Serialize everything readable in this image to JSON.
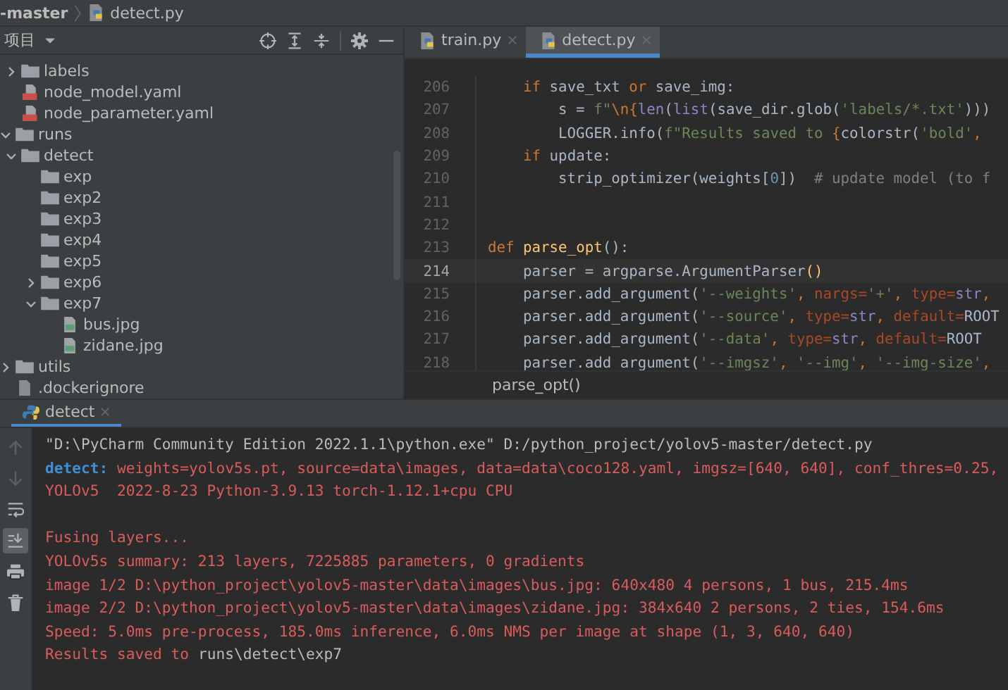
{
  "breadcrumb": [
    {
      "label": "-master"
    },
    {
      "label": "detect.py"
    }
  ],
  "project_panel": {
    "title": "项目",
    "tree": [
      {
        "children": [
          {
            "label": "labels",
            "kind": "folder",
            "expanded": false
          },
          {
            "label": "node_model.yaml",
            "kind": "yaml"
          },
          {
            "label": "node_parameter.yaml",
            "kind": "yaml"
          }
        ]
      },
      {
        "label": "runs",
        "kind": "folder",
        "expanded": true,
        "children": [
          {
            "label": "detect",
            "kind": "folder",
            "expanded": true,
            "children": [
              {
                "label": "exp",
                "kind": "folder"
              },
              {
                "label": "exp2",
                "kind": "folder"
              },
              {
                "label": "exp3",
                "kind": "folder"
              },
              {
                "label": "exp4",
                "kind": "folder"
              },
              {
                "label": "exp5",
                "kind": "folder"
              },
              {
                "label": "exp6",
                "kind": "folder",
                "expanded": false
              },
              {
                "label": "exp7",
                "kind": "folder",
                "expanded": true,
                "children": [
                  {
                    "label": "bus.jpg",
                    "kind": "image"
                  },
                  {
                    "label": "zidane.jpg",
                    "kind": "image"
                  }
                ]
              }
            ]
          }
        ]
      },
      {
        "label": "utils",
        "kind": "folder",
        "expanded": false
      },
      {
        "label": ".dockerignore",
        "kind": "file"
      }
    ]
  },
  "editor": {
    "tabs": [
      {
        "label": "train.py",
        "selected": false
      },
      {
        "label": "detect.py",
        "selected": true
      }
    ],
    "lines": [
      {
        "number": "206",
        "current": false,
        "segments": [
          {
            "text": "    if",
            "kind": "kw"
          },
          {
            "text": " save_txt ",
            "kind": "plain"
          },
          {
            "text": "or",
            "kind": "kw"
          },
          {
            "text": " save_img:",
            "kind": "plain"
          }
        ]
      },
      {
        "number": "207",
        "current": false,
        "segments": [
          {
            "text": "        s = ",
            "kind": "plain"
          },
          {
            "text": "f\"",
            "kind": "str"
          },
          {
            "text": "\\n{",
            "kind": "kw"
          },
          {
            "text": "len",
            "kind": "builtin"
          },
          {
            "text": "(",
            "kind": "plain"
          },
          {
            "text": "list",
            "kind": "builtin"
          },
          {
            "text": "(save_dir.glob(",
            "kind": "plain"
          },
          {
            "text": "'labels/*.txt'",
            "kind": "str"
          },
          {
            "text": ")))",
            "kind": "plain"
          }
        ]
      },
      {
        "number": "208",
        "current": false,
        "segments": [
          {
            "text": "        LOGGER.info(",
            "kind": "plain"
          },
          {
            "text": "f\"Results saved to ",
            "kind": "str"
          },
          {
            "text": "{",
            "kind": "kw"
          },
          {
            "text": "colorstr(",
            "kind": "plain"
          },
          {
            "text": "'bold'",
            "kind": "str"
          },
          {
            "text": ",",
            "kind": "kw"
          }
        ]
      },
      {
        "number": "209",
        "current": false,
        "segments": [
          {
            "text": "    if",
            "kind": "kw"
          },
          {
            "text": " update:",
            "kind": "plain"
          }
        ]
      },
      {
        "number": "210",
        "current": false,
        "segments": [
          {
            "text": "        strip_optimizer(weights[",
            "kind": "plain"
          },
          {
            "text": "0",
            "kind": "num"
          },
          {
            "text": "])  ",
            "kind": "plain"
          },
          {
            "text": "# update model (to f",
            "kind": "comment"
          }
        ]
      },
      {
        "number": "211",
        "current": false
      },
      {
        "number": "212",
        "current": false
      },
      {
        "number": "213",
        "current": false,
        "segments": [
          {
            "text": "def",
            "kind": "kw"
          },
          {
            "text": " parse_opt",
            "kind": "fn"
          },
          {
            "text": "():",
            "kind": "plain"
          }
        ]
      },
      {
        "number": "214",
        "current": true,
        "segments": [
          {
            "text": "    parser = argparse.ArgumentParser",
            "kind": "plain"
          },
          {
            "text": "()",
            "kind": "fn"
          }
        ]
      },
      {
        "number": "215",
        "current": false,
        "segments": [
          {
            "text": "    parser.add_argument(",
            "kind": "plain"
          },
          {
            "text": "'--weights'",
            "kind": "str"
          },
          {
            "text": ", ",
            "kind": "kw"
          },
          {
            "text": "nargs=",
            "kind": "param"
          },
          {
            "text": "'+'",
            "kind": "str"
          },
          {
            "text": ", ",
            "kind": "kw"
          },
          {
            "text": "type=",
            "kind": "param"
          },
          {
            "text": "str",
            "kind": "builtin"
          },
          {
            "text": ",",
            "kind": "kw"
          }
        ]
      },
      {
        "number": "216",
        "current": false,
        "segments": [
          {
            "text": "    parser.add_argument(",
            "kind": "plain"
          },
          {
            "text": "'--source'",
            "kind": "str"
          },
          {
            "text": ", ",
            "kind": "kw"
          },
          {
            "text": "type=",
            "kind": "param"
          },
          {
            "text": "str",
            "kind": "builtin"
          },
          {
            "text": ", ",
            "kind": "kw"
          },
          {
            "text": "default=",
            "kind": "param"
          },
          {
            "text": "ROOT",
            "kind": "plain"
          }
        ]
      },
      {
        "number": "217",
        "current": false,
        "segments": [
          {
            "text": "    parser.add_argument(",
            "kind": "plain"
          },
          {
            "text": "'--data'",
            "kind": "str"
          },
          {
            "text": ", ",
            "kind": "kw"
          },
          {
            "text": "type=",
            "kind": "param"
          },
          {
            "text": "str",
            "kind": "builtin"
          },
          {
            "text": ", ",
            "kind": "kw"
          },
          {
            "text": "default=",
            "kind": "param"
          },
          {
            "text": "ROOT",
            "kind": "plain"
          }
        ]
      },
      {
        "number": "218",
        "current": false,
        "segments": [
          {
            "text": "    parser.add_argument(",
            "kind": "plain"
          },
          {
            "text": "'--imgsz'",
            "kind": "str"
          },
          {
            "text": ", ",
            "kind": "kw"
          },
          {
            "text": "'--img'",
            "kind": "str"
          },
          {
            "text": ", ",
            "kind": "kw"
          },
          {
            "text": "'--img-size'",
            "kind": "str"
          },
          {
            "text": ",",
            "kind": "kw"
          }
        ]
      }
    ],
    "breadcrumb": "parse_opt()"
  },
  "run_panel": {
    "tab": "detect",
    "tools": [
      {
        "kind": "up",
        "selected": false
      },
      {
        "kind": "down",
        "selected": false
      },
      {
        "kind": "wrap",
        "selected": false
      },
      {
        "kind": "scroll",
        "selected": true
      },
      {
        "kind": "print",
        "selected": false
      },
      {
        "kind": "trash",
        "selected": false
      }
    ],
    "console": [
      {
        "spaced": false,
        "segments": [
          {
            "text": "\"D:\\PyCharm Community Edition 2022.1.1\\python.exe\" D:/python_project/yolov5-master/detect.py",
            "kind": "plain"
          }
        ]
      },
      {
        "spaced": false,
        "segments": [
          {
            "text": "detect: ",
            "kind": "info"
          },
          {
            "text": "weights=yolov5s.pt, source=data\\images, data=data\\coco128.yaml, imgsz=[640, 640], conf_thres=0.25,",
            "kind": "err"
          }
        ]
      },
      {
        "spaced": false,
        "segments": [
          {
            "text": "YOLOv5  2022-8-23 Python-3.9.13 torch-1.12.1+cpu CPU",
            "kind": "err"
          }
        ]
      },
      {
        "spaced": true,
        "segments": [
          {
            "text": "Fusing layers...",
            "kind": "err"
          }
        ]
      },
      {
        "spaced": false,
        "segments": [
          {
            "text": "YOLOv5s summary: 213 layers, 7225885 parameters, 0 gradients",
            "kind": "err"
          }
        ]
      },
      {
        "spaced": false,
        "segments": [
          {
            "text": "image 1/2 D:\\python_project\\yolov5-master\\data\\images\\bus.jpg: 640x480 4 persons, 1 bus, 215.4ms",
            "kind": "err"
          }
        ]
      },
      {
        "spaced": false,
        "segments": [
          {
            "text": "image 2/2 D:\\python_project\\yolov5-master\\data\\images\\zidane.jpg: 384x640 2 persons, 2 ties, 154.6ms",
            "kind": "err"
          }
        ]
      },
      {
        "spaced": false,
        "segments": [
          {
            "text": "Speed: 5.0ms pre-process, 185.0ms inference, 6.0ms NMS per image at shape (1, 3, 640, 640)",
            "kind": "err"
          }
        ]
      },
      {
        "spaced": false,
        "segments": [
          {
            "text": "Results saved to ",
            "kind": "err"
          },
          {
            "text": "runs\\detect\\exp7",
            "kind": "plain"
          }
        ]
      }
    ]
  }
}
